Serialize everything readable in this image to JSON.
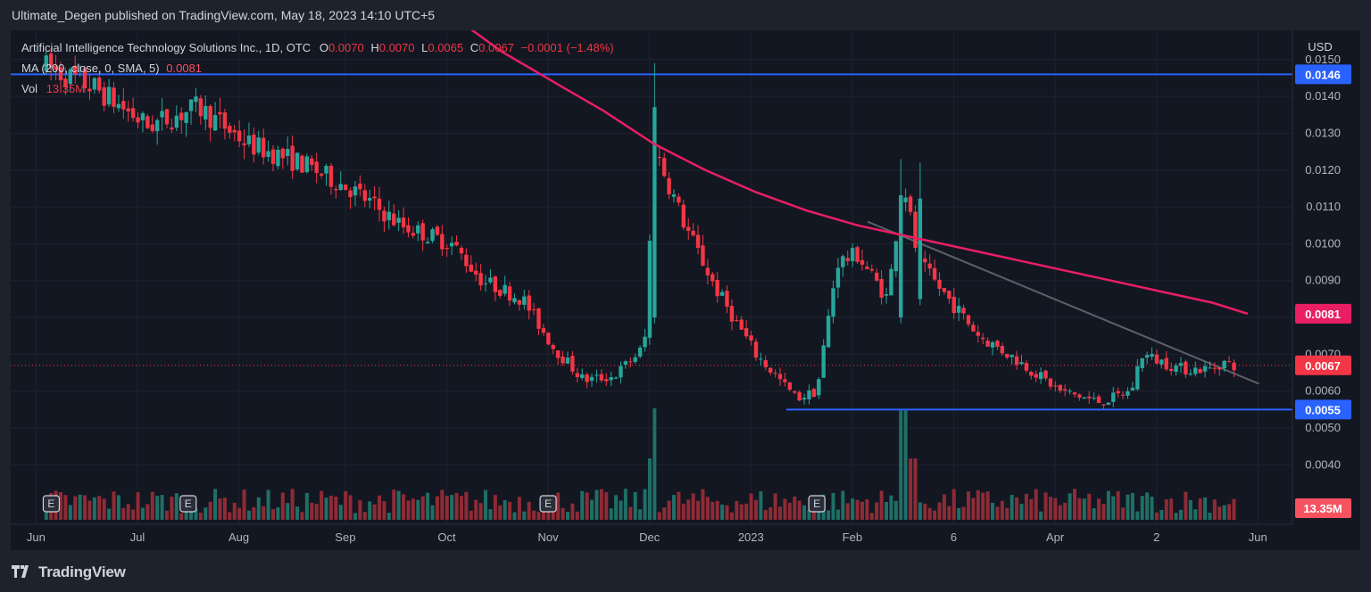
{
  "header": {
    "published": "Ultimate_Degen published on TradingView.com, May 18, 2023 14:10 UTC+5"
  },
  "legend": {
    "symbol": "Artificial Intelligence Technology Solutions Inc., 1D, OTC",
    "o_label": "O",
    "o_value": "0.0070",
    "h_label": "H",
    "h_value": "0.0070",
    "l_label": "L",
    "l_value": "0.0065",
    "c_label": "C",
    "c_value": "0.0067",
    "change": "−0.0001 (−1.48%)",
    "ma_label": "MA (200, close, 0, SMA, 5)",
    "ma_value": "0.0081",
    "vol_label": "Vol",
    "vol_value": "13.35M"
  },
  "footer": {
    "brand": "TradingView"
  },
  "colors": {
    "up": "#26a69a",
    "down": "#f23645",
    "ma": "#e91e63",
    "hline": "#2962ff",
    "trendline": "#5d606b",
    "background": "#131722"
  },
  "chart_data": {
    "type": "candlestick",
    "currency": "USD",
    "ylim": [
      0.0035,
      0.0156
    ],
    "y_ticks": [
      "0.0040",
      "0.0050",
      "0.0060",
      "0.0070",
      "0.0080",
      "0.0090",
      "0.0100",
      "0.0110",
      "0.0120",
      "0.0130",
      "0.0140",
      "0.0150"
    ],
    "x_labels": [
      {
        "label": "Jun",
        "month": 0.15
      },
      {
        "label": "Jul",
        "month": 1.15
      },
      {
        "label": "Aug",
        "month": 2.15
      },
      {
        "label": "Sep",
        "month": 3.2
      },
      {
        "label": "Oct",
        "month": 4.2
      },
      {
        "label": "Nov",
        "month": 5.2
      },
      {
        "label": "Dec",
        "month": 6.2
      },
      {
        "label": "2023",
        "month": 7.2
      },
      {
        "label": "Feb",
        "month": 8.2
      },
      {
        "label": "6",
        "month": 9.2
      },
      {
        "label": "Apr",
        "month": 10.2
      },
      {
        "label": "2",
        "month": 11.2
      },
      {
        "label": "Jun",
        "month": 12.2
      }
    ],
    "price_path": [
      [
        0,
        0.0148
      ],
      [
        0.5,
        0.0142
      ],
      [
        1.0,
        0.0132
      ],
      [
        1.5,
        0.0137
      ],
      [
        2.0,
        0.0127
      ],
      [
        2.5,
        0.0122
      ],
      [
        3.0,
        0.0115
      ],
      [
        3.5,
        0.0105
      ],
      [
        4.0,
        0.01
      ],
      [
        4.3,
        0.009
      ],
      [
        4.7,
        0.0085
      ],
      [
        5.0,
        0.0072
      ],
      [
        5.3,
        0.0063
      ],
      [
        5.6,
        0.0064
      ],
      [
        5.9,
        0.0072
      ],
      [
        6.0,
        0.0126
      ],
      [
        6.3,
        0.0105
      ],
      [
        6.6,
        0.0088
      ],
      [
        7.0,
        0.007
      ],
      [
        7.4,
        0.0058
      ],
      [
        7.6,
        0.006
      ],
      [
        7.8,
        0.0095
      ],
      [
        8.0,
        0.0097
      ],
      [
        8.3,
        0.0085
      ],
      [
        8.45,
        0.0118
      ],
      [
        8.6,
        0.0095
      ],
      [
        8.9,
        0.0085
      ],
      [
        9.2,
        0.0075
      ],
      [
        9.6,
        0.0068
      ],
      [
        10.0,
        0.006
      ],
      [
        10.4,
        0.0057
      ],
      [
        10.7,
        0.006
      ],
      [
        10.8,
        0.007
      ],
      [
        11.2,
        0.0066
      ],
      [
        11.5,
        0.0066
      ],
      [
        11.6,
        0.0068
      ],
      [
        11.7,
        0.0067
      ]
    ],
    "spikes": [
      {
        "month": 6.0,
        "high": 0.0149,
        "low": 0.008
      },
      {
        "month": 8.45,
        "high": 0.0123,
        "low": 0.008
      },
      {
        "month": 8.6,
        "high": 0.0122,
        "low": 0.0085
      }
    ],
    "moving_average": {
      "name": "MA (200, close, 0, SMA, 5)",
      "points": [
        [
          4.1,
          0.016
        ],
        [
          4.5,
          0.0152
        ],
        [
          5.0,
          0.0144
        ],
        [
          5.5,
          0.0136
        ],
        [
          6.0,
          0.0127
        ],
        [
          6.5,
          0.012
        ],
        [
          7.0,
          0.0114
        ],
        [
          7.5,
          0.0109
        ],
        [
          8.0,
          0.0105
        ],
        [
          8.5,
          0.0102
        ],
        [
          9.0,
          0.0099
        ],
        [
          9.5,
          0.0096
        ],
        [
          10.0,
          0.0093
        ],
        [
          10.5,
          0.009
        ],
        [
          11.0,
          0.0087
        ],
        [
          11.5,
          0.0084
        ],
        [
          11.85,
          0.0081
        ]
      ]
    },
    "horizontal_lines": [
      {
        "value": 0.0146,
        "label": "0.0146"
      },
      {
        "value": 0.0055,
        "label": "0.0055",
        "from_month": 7.3
      }
    ],
    "trendline": [
      [
        8.1,
        0.0106
      ],
      [
        11.96,
        0.0062
      ]
    ],
    "last_price": {
      "value": 0.0067,
      "label": "0.0067"
    },
    "ma_last": {
      "value": 0.0081,
      "label": "0.0081"
    },
    "volume_label": "13.35M",
    "earnings_markers": [
      {
        "label": "E",
        "month": 0.05
      },
      {
        "label": "E",
        "month": 1.4
      },
      {
        "label": "E",
        "month": 4.95
      },
      {
        "label": "E",
        "month": 7.6
      }
    ],
    "volume_spikes": [
      {
        "month": 6.0,
        "value": 1.0
      },
      {
        "month": 5.95,
        "value": 0.55
      },
      {
        "month": 8.45,
        "value": 0.98
      },
      {
        "month": 8.55,
        "value": 0.55
      }
    ]
  }
}
